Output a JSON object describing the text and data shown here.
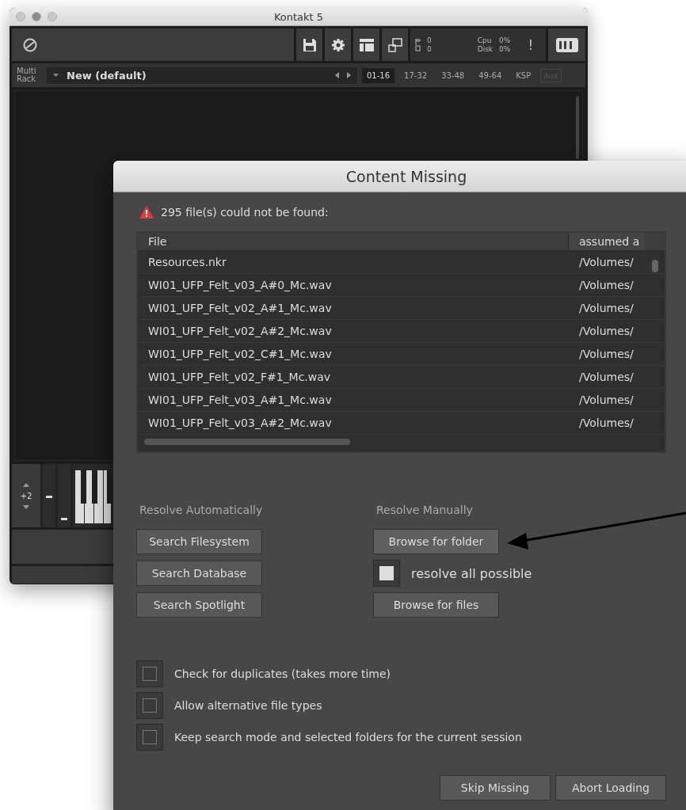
{
  "kontakt": {
    "title": "Kontakt 5",
    "toolbar": {
      "midi_in": "0",
      "midi_out": "0",
      "cpu_label": "Cpu",
      "cpu_value": "0%",
      "disk_label": "Disk",
      "disk_value": "0%",
      "alert": "!"
    },
    "rack": {
      "label": "Multi Rack",
      "preset": "New (default)",
      "tabs": [
        {
          "label": "01-16",
          "selected": true,
          "disabled": false
        },
        {
          "label": "17-32",
          "selected": false,
          "disabled": false
        },
        {
          "label": "33-48",
          "selected": false,
          "disabled": false
        },
        {
          "label": "49-64",
          "selected": false,
          "disabled": false
        },
        {
          "label": "KSP",
          "selected": false,
          "disabled": false
        },
        {
          "label": "aux",
          "selected": false,
          "disabled": true
        }
      ]
    },
    "keyboard": {
      "octave": "+2"
    }
  },
  "dialog": {
    "title": "Content Missing",
    "warning": "295 file(s) could not be found:",
    "columns": [
      "File",
      "assumed a"
    ],
    "rows": [
      [
        "Resources.nkr",
        "/Volumes/"
      ],
      [
        "WI01_UFP_Felt_v03_A#0_Mc.wav",
        "/Volumes/"
      ],
      [
        "WI01_UFP_Felt_v02_A#1_Mc.wav",
        "/Volumes/"
      ],
      [
        "WI01_UFP_Felt_v02_A#2_Mc.wav",
        "/Volumes/"
      ],
      [
        "WI01_UFP_Felt_v02_C#1_Mc.wav",
        "/Volumes/"
      ],
      [
        "WI01_UFP_Felt_v02_F#1_Mc.wav",
        "/Volumes/"
      ],
      [
        "WI01_UFP_Felt_v03_A#1_Mc.wav",
        "/Volumes/"
      ],
      [
        "WI01_UFP_Felt_v03_A#2_Mc.wav",
        "/Volumes/"
      ]
    ],
    "auto": {
      "heading": "Resolve Automatically",
      "buttons": [
        "Search Filesystem",
        "Search Database",
        "Search Spotlight"
      ]
    },
    "manual": {
      "heading": "Resolve Manually",
      "browse_folder": "Browse for folder",
      "resolve_all": {
        "label": "resolve all possible",
        "checked": true
      },
      "browse_files": "Browse for files"
    },
    "options": [
      {
        "label": "Check for duplicates (takes more time)",
        "checked": false
      },
      {
        "label": "Allow alternative file types",
        "checked": false
      },
      {
        "label": "Keep search mode and selected folders for the current session",
        "checked": false
      }
    ],
    "buttons": [
      "Skip Missing",
      "Abort Loading"
    ]
  }
}
